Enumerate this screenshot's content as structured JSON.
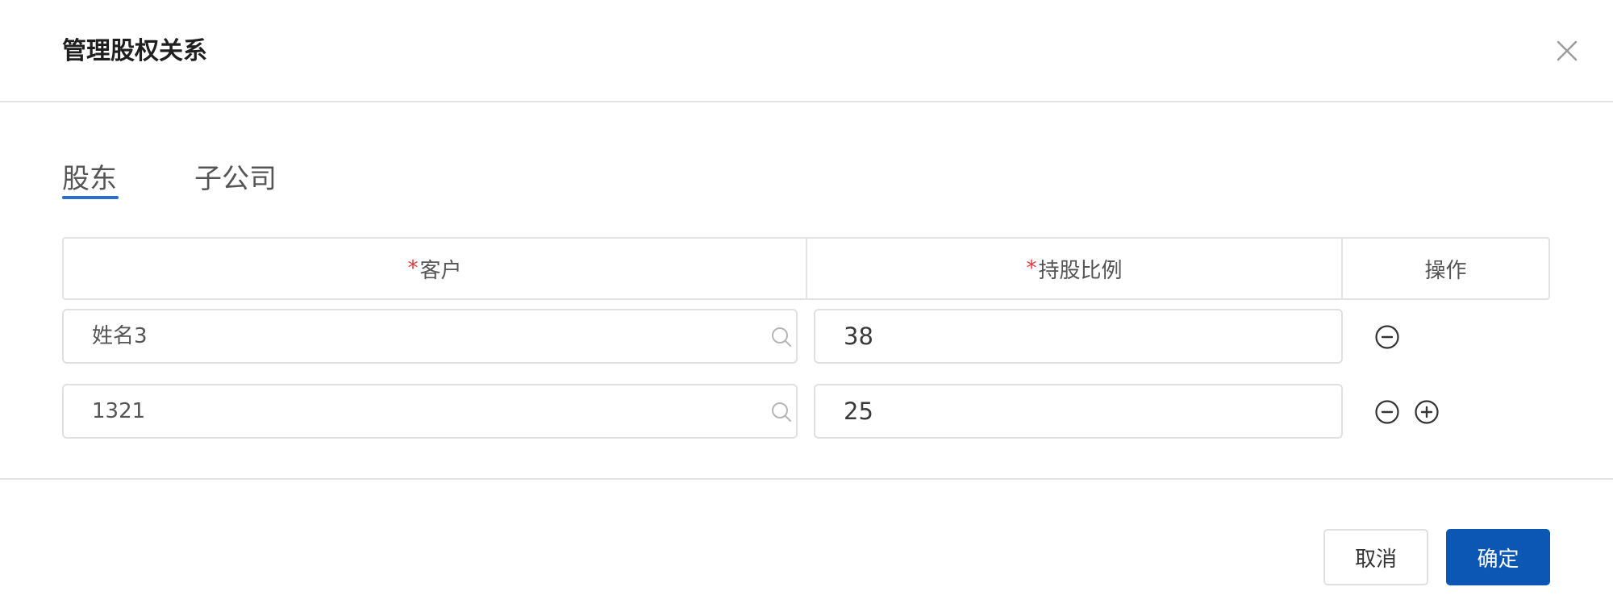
{
  "dialog": {
    "title": "管理股权关系",
    "close_icon": "close-icon"
  },
  "tabs": [
    {
      "label": "股东",
      "active": true
    },
    {
      "label": "子公司",
      "active": false
    }
  ],
  "table": {
    "columns": [
      {
        "required_mark": "*",
        "label": "客户"
      },
      {
        "required_mark": "*",
        "label": "持股比例"
      },
      {
        "label": "操作"
      }
    ],
    "rows": [
      {
        "customer": "姓名3",
        "ratio": "38",
        "actions": [
          "remove-circle-icon"
        ]
      },
      {
        "customer": "1321",
        "ratio": "25",
        "actions": [
          "remove-circle-icon",
          "add-circle-icon"
        ]
      }
    ]
  },
  "footer": {
    "cancel_label": "取消",
    "confirm_label": "确定"
  },
  "colors": {
    "accent": "#0b57b3",
    "tab_underline": "#2a6ed0",
    "required": "#e0393e",
    "border": "#e0e0e0"
  }
}
